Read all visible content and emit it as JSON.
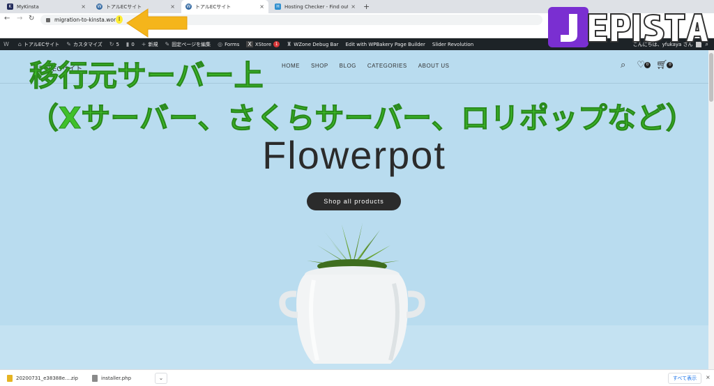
{
  "browser": {
    "tabs": [
      {
        "title": "MyKinsta",
        "favicon_color": "#232b5b",
        "favicon_letter": "K"
      },
      {
        "title": "トアルECサイト",
        "favicon_color": "#3a6ea5",
        "favicon_letter": "W"
      },
      {
        "title": "トアルECサイト",
        "favicon_color": "#3a6ea5",
        "favicon_letter": "W"
      },
      {
        "title": "Hosting Checker - Find out who",
        "favicon_color": "#2f8fcf",
        "favicon_letter": "H"
      }
    ],
    "new_tab_symbol": "+",
    "close_symbol": "×",
    "address": "migration-to-kinsta.work",
    "cursor_glyph": "I"
  },
  "admin_bar": {
    "items": [
      {
        "icon": "W",
        "label": ""
      },
      {
        "icon": "⌂",
        "label": "トアルECサイト"
      },
      {
        "icon": "✎",
        "label": "カスタマイズ"
      },
      {
        "icon": "↻",
        "label": "5"
      },
      {
        "icon": "▮",
        "label": "0"
      },
      {
        "icon": "+",
        "label": "新規"
      },
      {
        "icon": "✎",
        "label": "固定ページを編集"
      },
      {
        "icon": "◎",
        "label": "Forms"
      },
      {
        "icon": "X",
        "label": "XStore"
      },
      {
        "icon": "♜",
        "label": "WZone Debug Bar"
      },
      {
        "icon": "",
        "label": "Edit with WPBakery Page Builder"
      },
      {
        "icon": "",
        "label": "Slider Revolution"
      }
    ],
    "xstore_badge": "1",
    "greeting": "こんにちは、yfukaya さん"
  },
  "site": {
    "logo_text": "トアルECサイト",
    "nav": [
      "HOME",
      "SHOP",
      "BLOG",
      "CATEGORIES",
      "ABOUT US"
    ],
    "wishlist_count": "0",
    "cart_count": "0",
    "hero_title": "Flowerpot",
    "cta_label": "Shop all products",
    "background_color": "#b9dcef"
  },
  "overlay": {
    "line1": "移行元サーバー上",
    "line2": "（Xサーバー、さくらサーバー、ロリポップなど）",
    "text_color": "#3fc02b",
    "brand": "JEPISTA"
  },
  "downloads": {
    "files": [
      {
        "name": "20200731_e38388e....zip",
        "icon_color": "#e6b422"
      },
      {
        "name": "installer.php",
        "icon_color": "#8a8a8a"
      }
    ],
    "chevron": "⌄",
    "show_all_label": "すべて表示",
    "close_symbol": "×"
  }
}
